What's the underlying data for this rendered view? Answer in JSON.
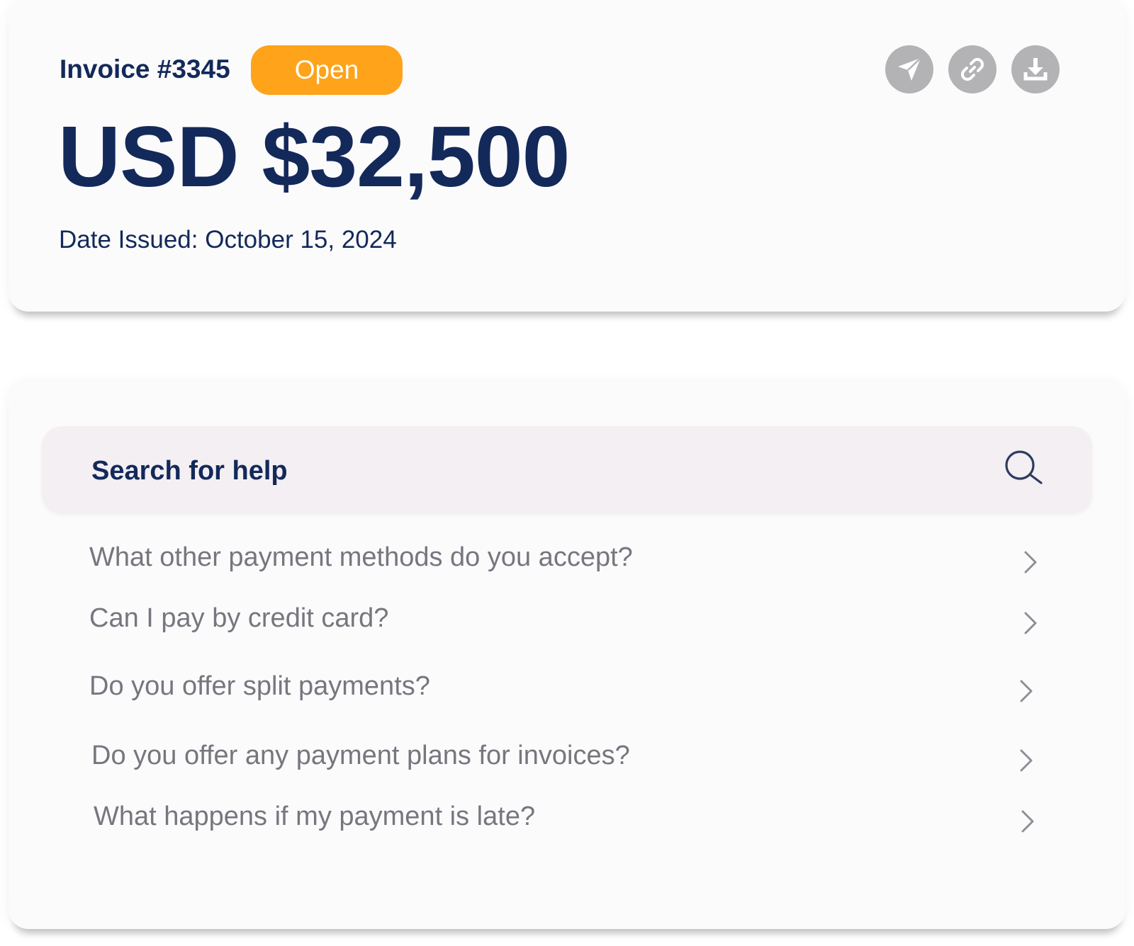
{
  "invoice": {
    "number_label": "Invoice #3345",
    "status": "Open",
    "amount": "USD $32,500",
    "date_issued": "Date Issued: October 15, 2024",
    "actions": [
      {
        "name": "send",
        "icon": "send-icon"
      },
      {
        "name": "copy-link",
        "icon": "link-icon"
      },
      {
        "name": "download",
        "icon": "download-icon"
      }
    ]
  },
  "help": {
    "search_label": "Search for help",
    "faq": [
      {
        "question": "What other payment methods do you accept?"
      },
      {
        "question": "Can I pay by credit card?"
      },
      {
        "question": "Do you offer split payments?"
      },
      {
        "question": "Do you offer any payment plans for invoices?"
      },
      {
        "question": "What happens if my payment is late?"
      }
    ]
  },
  "colors": {
    "primary_text": "#13295a",
    "status_open": "#ffa31a",
    "icon_button_bg": "#b3b2b5",
    "faq_text": "#76777e",
    "search_bg": "#f3eff3"
  }
}
